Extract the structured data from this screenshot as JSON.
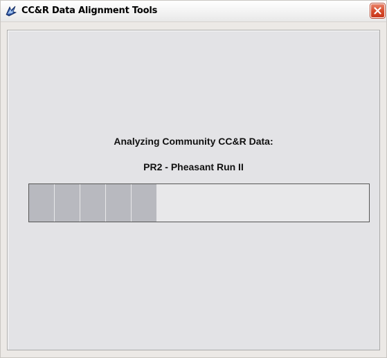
{
  "window": {
    "title": "CC&R Data Alignment Tools",
    "app_icon": "app-icon",
    "close_icon": "close-icon"
  },
  "main": {
    "heading": "Analyzing Community CC&R Data:",
    "community": "PR2 - Pheasant Run II"
  },
  "progress": {
    "fraction": 0.38,
    "segments_filled": 5,
    "fill_color": "#b8b9bf"
  },
  "colors": {
    "close_button": "#d64a2a",
    "panel_background": "#e3e3e6",
    "window_background": "#ece9e6"
  }
}
